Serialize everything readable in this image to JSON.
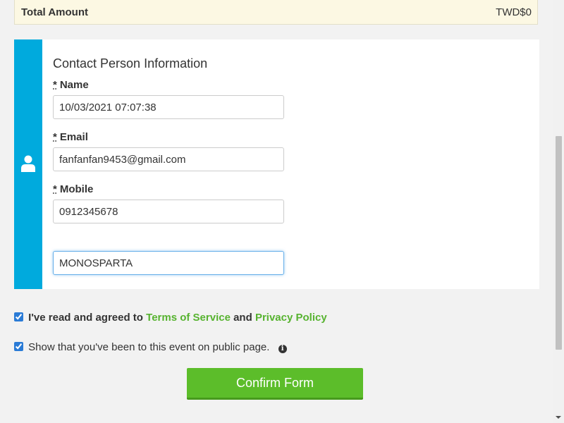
{
  "summary": {
    "total_label": "Total Amount",
    "total_value": "TWD$0"
  },
  "contact": {
    "title": "Contact Person Information",
    "required_mark": "*",
    "fields": [
      {
        "label": "Name",
        "value": "10/03/2021 07:07:38"
      },
      {
        "label": "Email",
        "value": "fanfanfan9453@gmail.com"
      },
      {
        "label": "Mobile",
        "value": "0912345678"
      },
      {
        "label": "",
        "value": "MONOSPARTA"
      }
    ]
  },
  "agreement": {
    "prefix": "I've read and agreed to",
    "terms_link": "Terms of Service",
    "and": "and",
    "privacy_link": "Privacy Policy",
    "checked": true
  },
  "public_option": {
    "label": "Show that you've been to this event on public page.",
    "checked": true,
    "info_icon": "i"
  },
  "confirm_button": {
    "label": "Confirm Form"
  },
  "colors": {
    "strip": "#00aadd",
    "link": "#57b330",
    "button": "#5cbd2a"
  },
  "icons": {
    "user": "user-icon",
    "info": "info-icon"
  }
}
